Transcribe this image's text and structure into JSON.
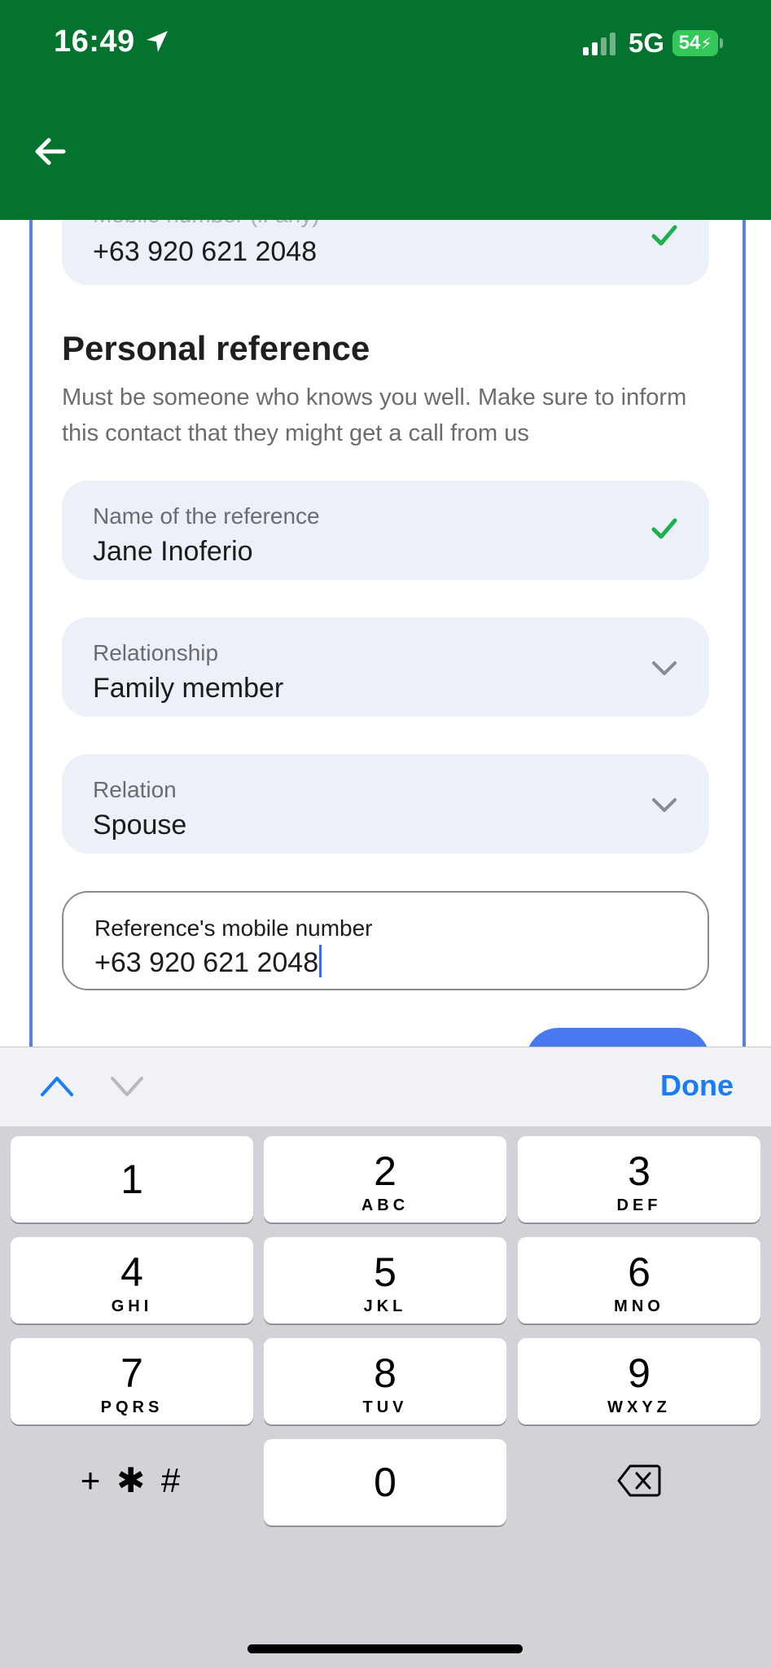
{
  "status_bar": {
    "time": "16:49",
    "network": "5G",
    "battery": "54"
  },
  "header": {
    "back_icon": "arrow-left-icon"
  },
  "form": {
    "top_field": {
      "label": "Mobile number (if any)",
      "value": "+63 920 621 2048"
    },
    "section": {
      "title": "Personal reference",
      "description": "Must be someone who knows you well. Make sure to inform this contact that they might get a call from us"
    },
    "reference_name": {
      "label": "Name of the reference",
      "value": "Jane Inoferio"
    },
    "relationship": {
      "label": "Relationship",
      "value": "Family member"
    },
    "relation": {
      "label": "Relation",
      "value": "Spouse"
    },
    "reference_mobile": {
      "label": "Reference's mobile number",
      "value": "+63 920 621 2048"
    }
  },
  "keyboard": {
    "done_label": "Done",
    "keys": [
      {
        "digit": "1",
        "letters": ""
      },
      {
        "digit": "2",
        "letters": "ABC"
      },
      {
        "digit": "3",
        "letters": "DEF"
      },
      {
        "digit": "4",
        "letters": "GHI"
      },
      {
        "digit": "5",
        "letters": "JKL"
      },
      {
        "digit": "6",
        "letters": "MNO"
      },
      {
        "digit": "7",
        "letters": "PQRS"
      },
      {
        "digit": "8",
        "letters": "TUV"
      },
      {
        "digit": "9",
        "letters": "WXYZ"
      },
      {
        "digit": "0",
        "letters": ""
      }
    ],
    "symbols_label": "+ ✱ #"
  },
  "colors": {
    "header_green": "#03732f",
    "accent_blue": "#4a78ee",
    "check_green": "#1eb04c",
    "field_bg": "#ecf0f7"
  }
}
